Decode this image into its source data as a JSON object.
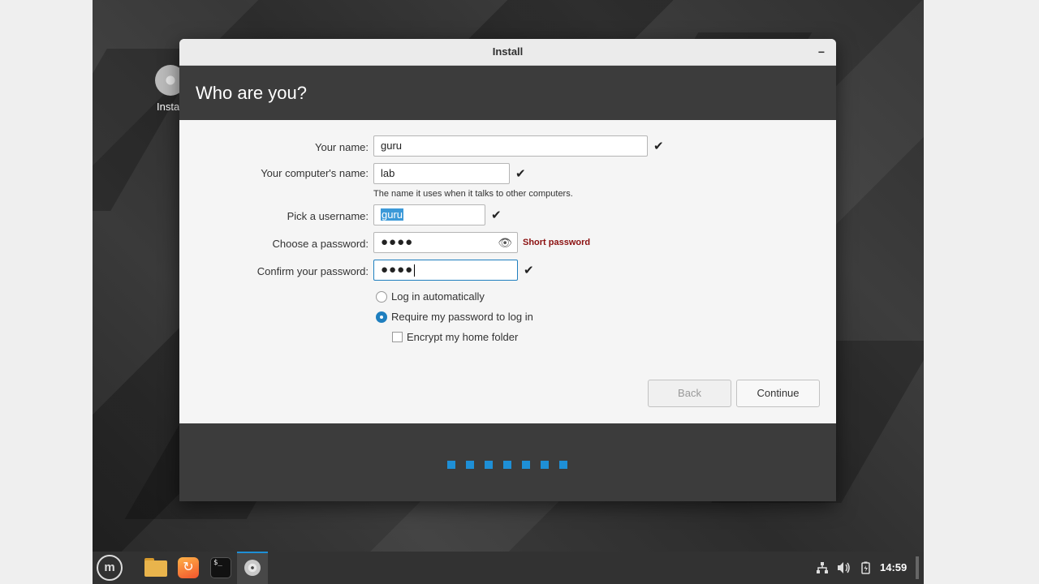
{
  "desktop": {
    "icon_label": "Install"
  },
  "window": {
    "title": "Install",
    "minimize_glyph": "−",
    "heading": "Who are you?"
  },
  "form": {
    "name": {
      "label": "Your name:",
      "value": "guru"
    },
    "computer": {
      "label": "Your computer's name:",
      "value": "lab",
      "hint": "The name it uses when it talks to other computers."
    },
    "username": {
      "label": "Pick a username:",
      "value": "guru"
    },
    "password": {
      "label": "Choose a password:",
      "masked": "●●●●",
      "strength": "Short password"
    },
    "confirm": {
      "label": "Confirm your password:",
      "masked": "●●●●"
    },
    "login_auto": {
      "label": "Log in automatically",
      "selected": false
    },
    "login_password": {
      "label": "Require my password to log in",
      "selected": true
    },
    "encrypt_home": {
      "label": "Encrypt my home folder",
      "checked": false
    },
    "check_glyph": "✔",
    "eye_glyph": "👁"
  },
  "buttons": {
    "back": "Back",
    "continue": "Continue"
  },
  "progress": {
    "steps": 7
  },
  "taskbar": {
    "menu_glyph": "m",
    "terminal_glyph": "$_",
    "firefox_glyph": "↻",
    "clock": "14:59",
    "icons": [
      "network-icon",
      "volume-icon",
      "battery-icon"
    ]
  },
  "colors": {
    "accent": "#1e8fd6",
    "warning": "#8b1010",
    "header_bg": "#3c3c3c"
  }
}
